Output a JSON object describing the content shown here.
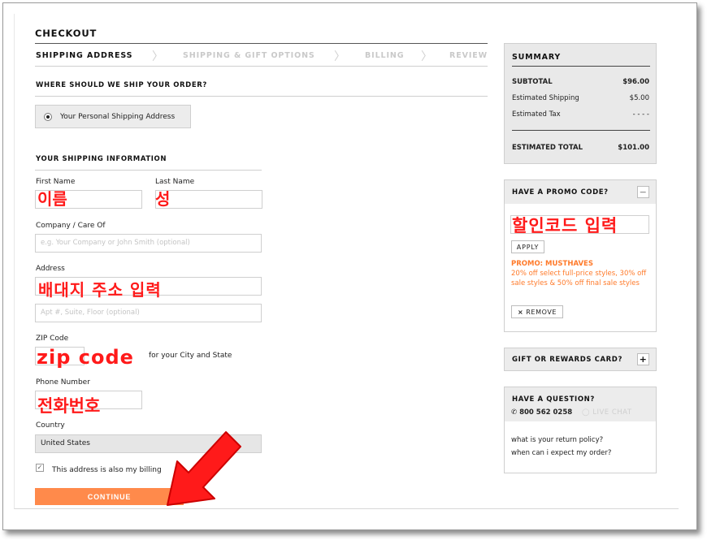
{
  "header": {
    "title": "CHECKOUT"
  },
  "steps": [
    {
      "label": "SHIPPING ADDRESS"
    },
    {
      "label": "SHIPPING & GIFT OPTIONS"
    },
    {
      "label": "BILLING"
    },
    {
      "label": "REVIEW"
    }
  ],
  "step_separator": "〉",
  "ship_question": "WHERE SHOULD WE SHIP YOUR ORDER?",
  "address_option": "Your Personal Shipping Address",
  "shipping_info_title": "YOUR SHIPPING INFORMATION",
  "form": {
    "first_name_label": "First Name",
    "last_name_label": "Last Name",
    "company_label": "Company / Care Of",
    "company_placeholder": "e.g. Your Company or John Smith (optional)",
    "address_label": "Address",
    "address2_placeholder": "Apt #, Suite, Floor (optional)",
    "zip_label": "ZIP Code",
    "zip_hint": "for your City and State",
    "phone_label": "Phone Number",
    "country_label": "Country",
    "country_value": "United States",
    "billing_checkbox_label": "This address is also my billing",
    "continue_label": "CONTINUE"
  },
  "annotations": {
    "first_name": "이름",
    "last_name": "성",
    "address": "배대지 주소 입력",
    "zip": "zip code",
    "phone": "전화번호",
    "promo": "할인코드 입력"
  },
  "summary": {
    "title": "SUMMARY",
    "subtotal_label": "SUBTOTAL",
    "subtotal_value": "$96.00",
    "shipping_label": "Estimated Shipping",
    "shipping_value": "$5.00",
    "tax_label": "Estimated Tax",
    "tax_value": "- - - -",
    "total_label": "ESTIMATED TOTAL",
    "total_value": "$101.00"
  },
  "promo": {
    "title": "HAVE A PROMO CODE?",
    "toggle": "−",
    "apply_label": "APPLY",
    "promo_name": "PROMO: MUSTHAVES",
    "promo_desc": "20% off select full-price styles, 30% off sale styles & 50% off final sale styles",
    "remove_label": "REMOVE",
    "remove_icon": "×"
  },
  "gift_card": {
    "title": "GIFT OR REWARDS CARD?",
    "toggle": "+"
  },
  "question": {
    "title": "HAVE A QUESTION?",
    "phone": "800 562 0258",
    "chat": "LIVE CHAT",
    "link1": "what is your return policy?",
    "link2": "when can i expect my order?"
  },
  "colors": {
    "accent_orange": "#ff8a4b",
    "promo_orange": "#ff7a2a",
    "annotation_red": "#ff1a1a"
  }
}
